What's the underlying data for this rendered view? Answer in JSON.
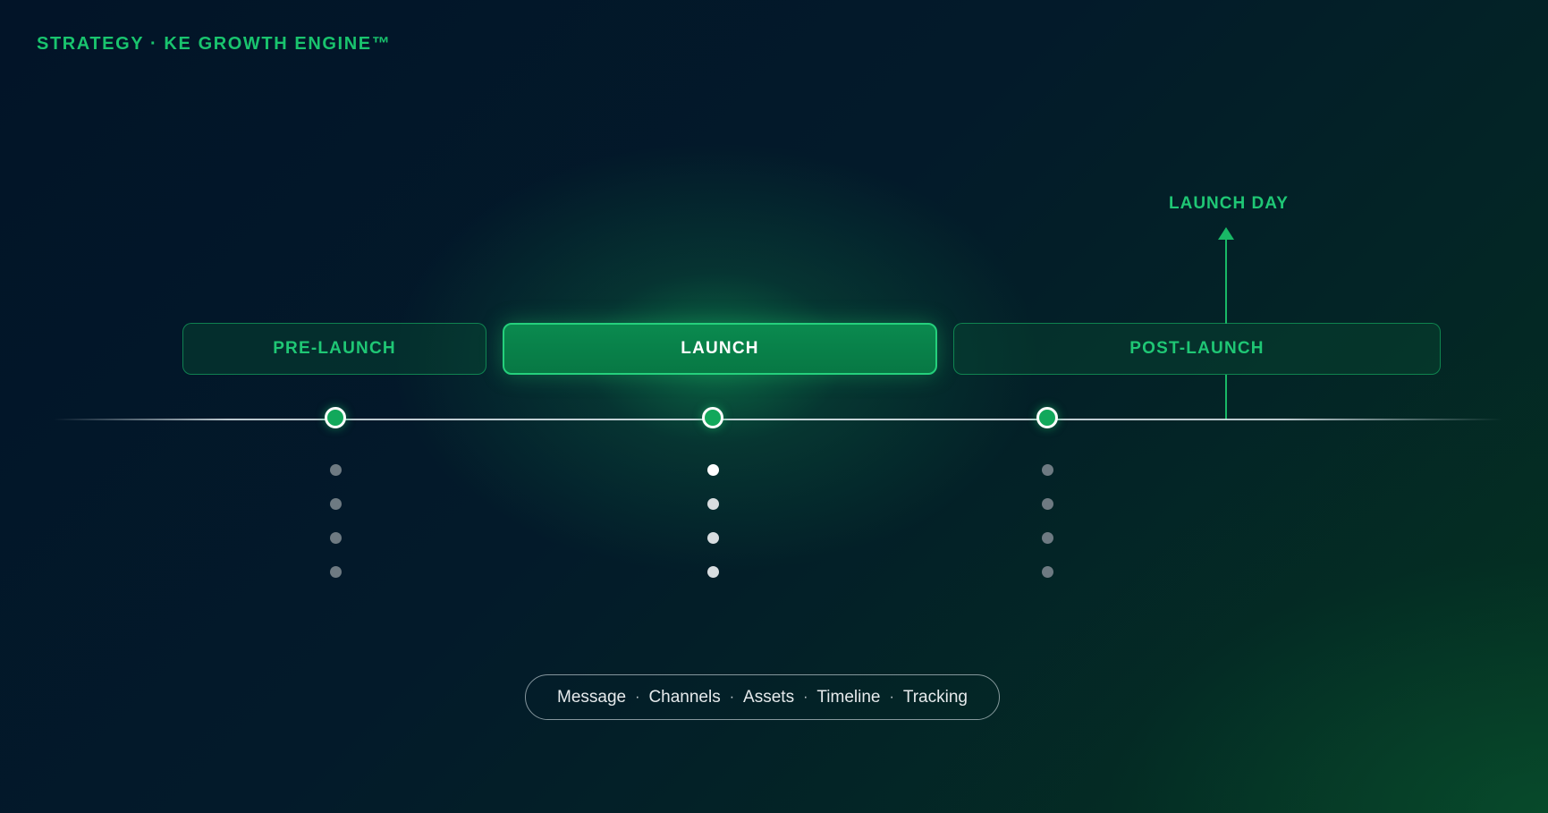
{
  "header": {
    "brand": "STRATEGY · KE GROWTH ENGINE™"
  },
  "phases": [
    {
      "label": "PRE-LAUNCH"
    },
    {
      "label": "LAUNCH"
    },
    {
      "label": "POST-LAUNCH"
    }
  ],
  "marker": {
    "label": "LAUNCH DAY"
  },
  "pill": {
    "items": [
      "Message",
      "Channels",
      "Assets",
      "Timeline",
      "Tracking"
    ],
    "separator": "·"
  },
  "colors": {
    "accent": "#19c46e",
    "accent_bright": "#25d07c",
    "background": "#021428",
    "text_light": "#e6eaec"
  }
}
